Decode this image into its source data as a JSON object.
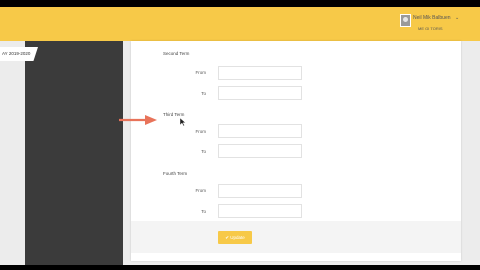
{
  "header": {
    "user_name": "Neil Mik Balbuen",
    "user_subtitle": "ME GI TORIS",
    "caret": "⌄"
  },
  "sidebar": {
    "ay_label": "AY 2019-2020"
  },
  "sections": [
    {
      "title": "Second Term",
      "from_label": "From",
      "to_label": "To",
      "from_value": "",
      "to_value": ""
    },
    {
      "title": "Third Term",
      "from_label": "From",
      "to_label": "To",
      "from_value": "",
      "to_value": ""
    },
    {
      "title": "Fourth Term",
      "from_label": "From",
      "to_label": "To",
      "from_value": "",
      "to_value": ""
    }
  ],
  "footer": {
    "update_label": "✔ Update"
  },
  "colors": {
    "accent": "#f7c948",
    "sidebar": "#3b3b3b",
    "arrow": "#e8735a"
  }
}
